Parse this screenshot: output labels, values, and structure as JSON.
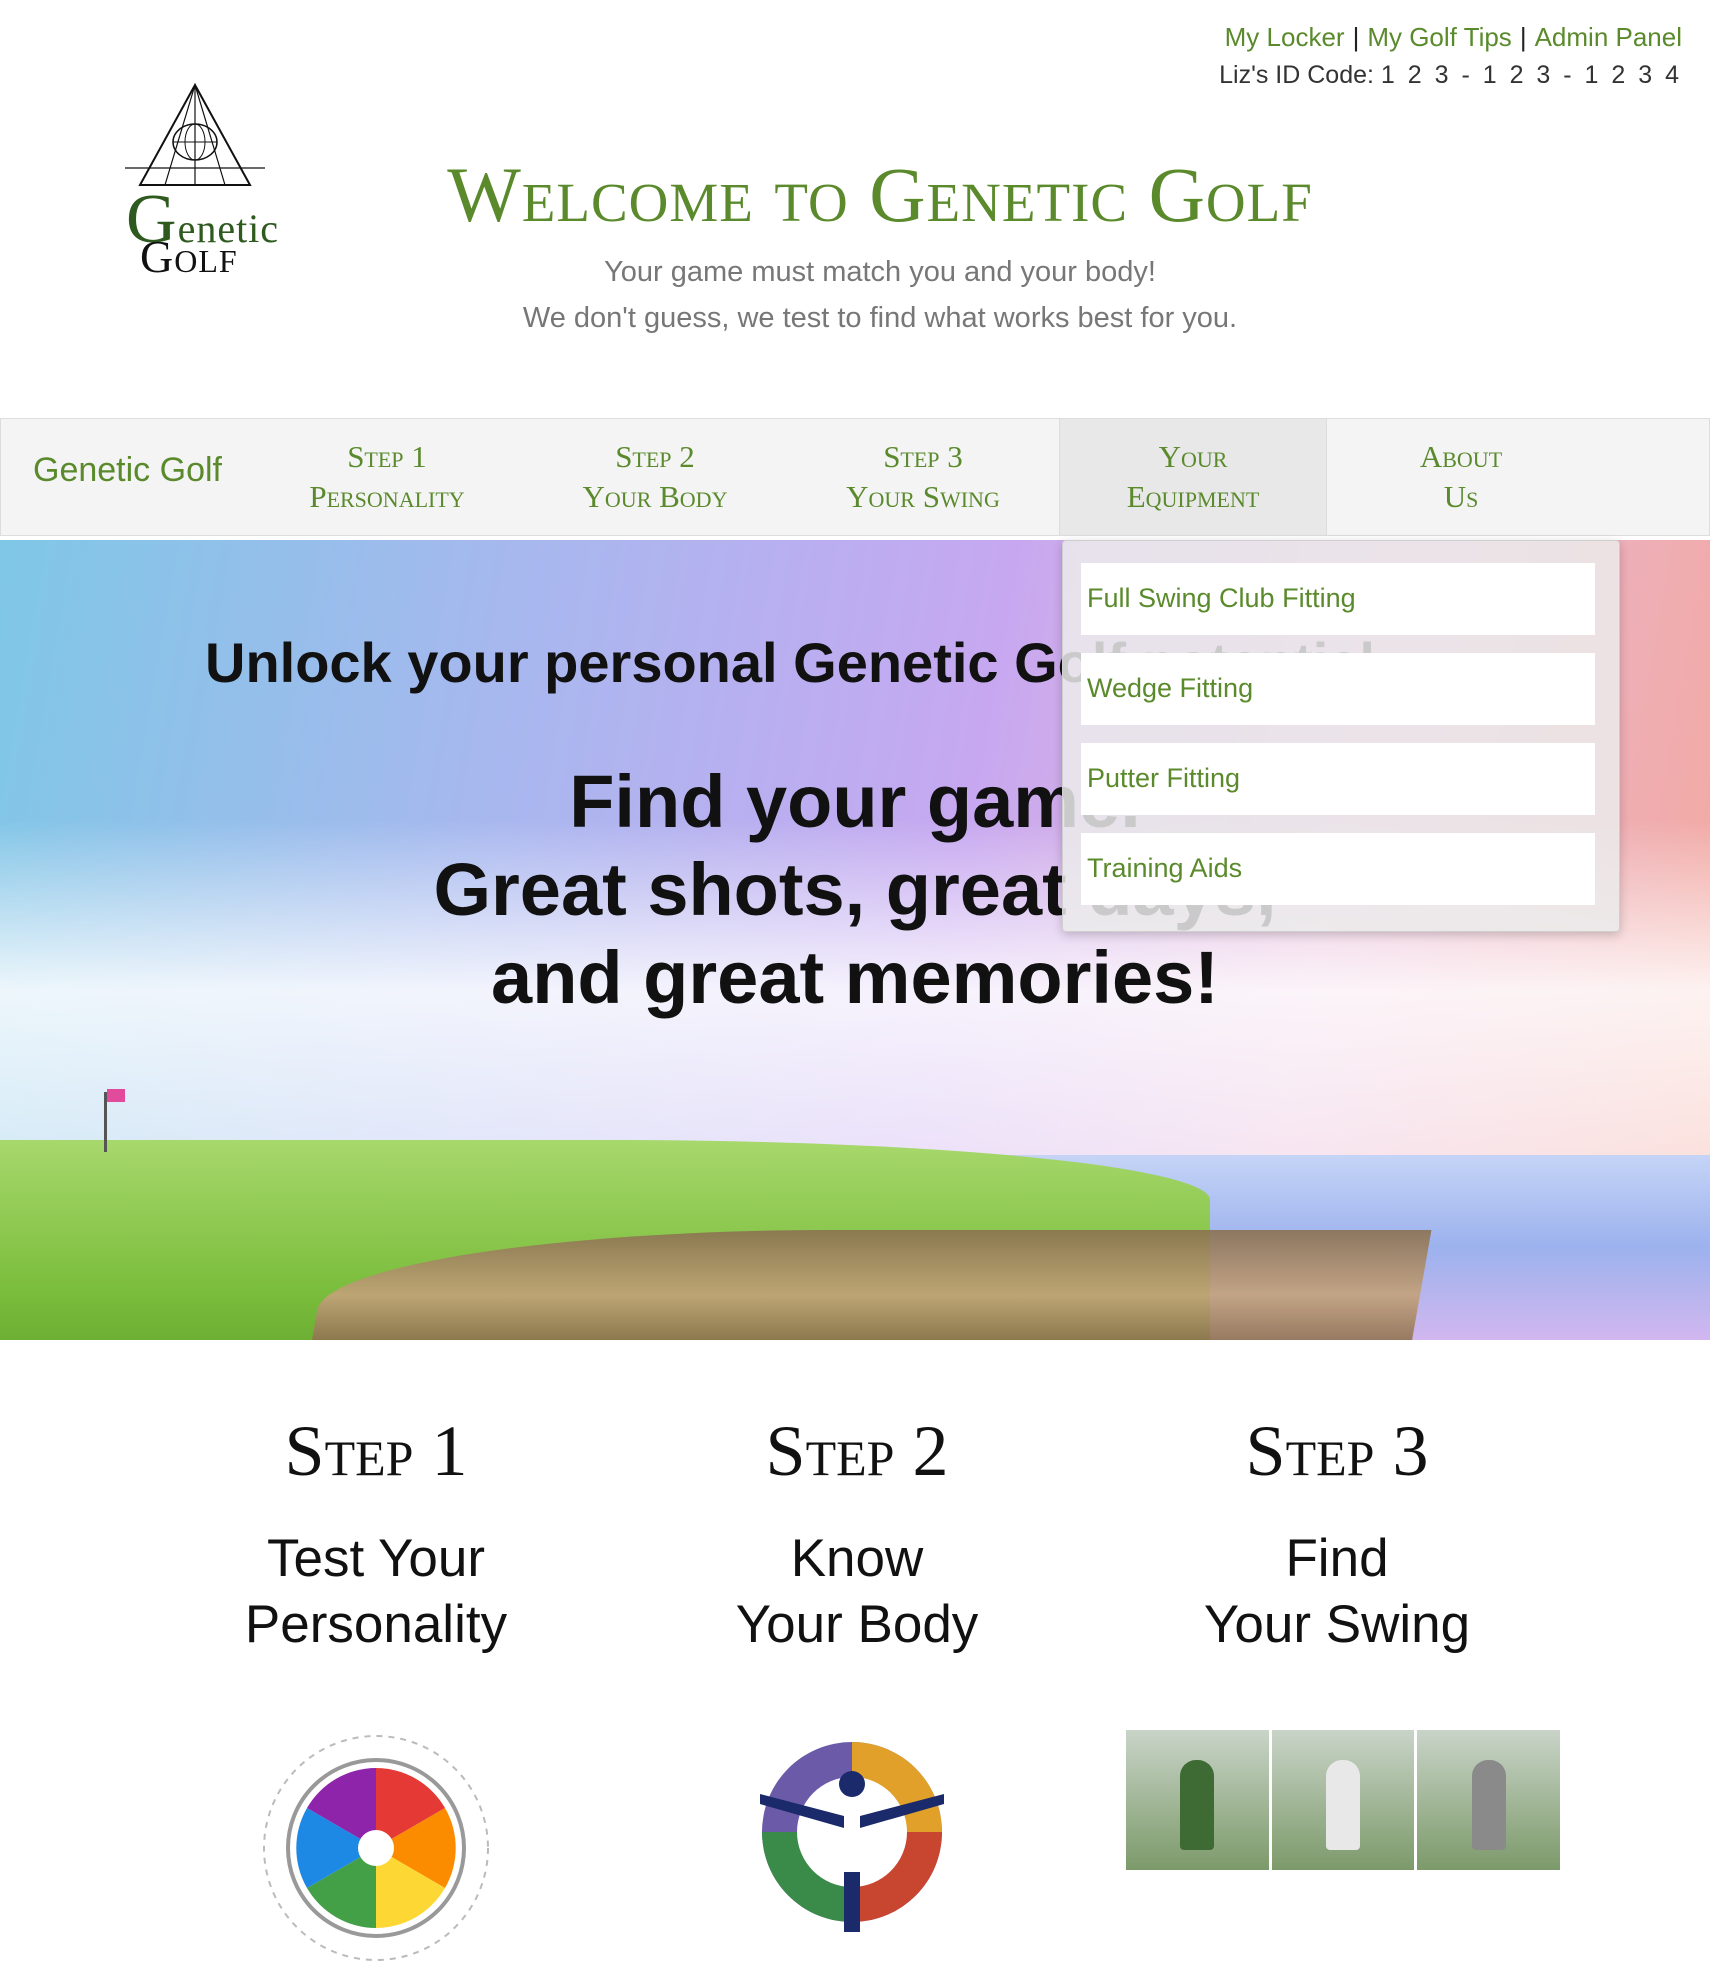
{
  "utility": {
    "links": [
      "My Locker",
      "My Golf Tips",
      "Admin Panel"
    ],
    "separator": "|",
    "id_label": "Liz's ID Code:",
    "id_code": "1 2 3 - 1 2 3 - 1 2 3 4"
  },
  "logo": {
    "word_top": "enetic",
    "word_top_initial": "G",
    "word_bottom": "Golf"
  },
  "header": {
    "title": "Welcome to Genetic Golf",
    "tagline_1": "Your game must match you and your body!",
    "tagline_2": "We don't guess, we test to find what works best for you."
  },
  "nav": {
    "brand": "Genetic Golf",
    "items": [
      {
        "line1": "Step 1",
        "line2": "Personality"
      },
      {
        "line1": "Step 2",
        "line2": "Your Body"
      },
      {
        "line1": "Step 3",
        "line2": "Your Swing"
      },
      {
        "line1": "Your",
        "line2": "Equipment"
      },
      {
        "line1": "About",
        "line2": "Us"
      }
    ],
    "active_index": 3
  },
  "dropdown": {
    "items": [
      "Full Swing Club Fitting",
      "Wedge Fitting",
      "Putter Fitting",
      "Training Aids"
    ]
  },
  "hero": {
    "line1": "Unlock your personal Genetic Golf potential",
    "big_1": "Find your game.",
    "big_2": "Great shots, great days,",
    "big_3": "and great memories!"
  },
  "steps": [
    {
      "title": "Step 1",
      "sub_1": "Test Your",
      "sub_2": "Personality"
    },
    {
      "title": "Step 2",
      "sub_1": "Know",
      "sub_2": "Your Body"
    },
    {
      "title": "Step 3",
      "sub_1": "Find",
      "sub_2": "Your Swing"
    }
  ],
  "colors": {
    "brand_green": "#5a8a2c",
    "nav_bg": "#f4f4f4"
  }
}
